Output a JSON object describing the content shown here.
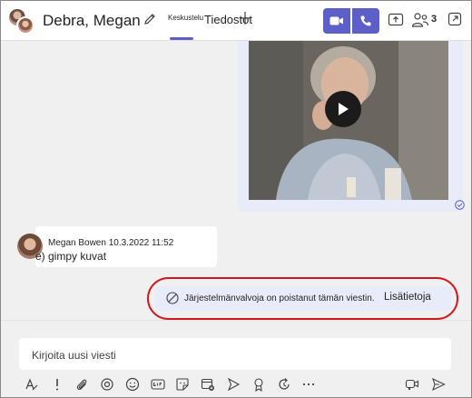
{
  "header": {
    "title": "Debra, Megan",
    "tabs": [
      {
        "label": "Keskustelu",
        "active": true
      },
      {
        "label": "Tiedostot",
        "active": false
      }
    ],
    "participant_count": "3"
  },
  "messages": [
    {
      "type": "video",
      "media": "video-thumbnail"
    },
    {
      "type": "text",
      "author_meta": "Megan Bowen 10.3.2022 11:52",
      "text": "e) gimpy kuvat"
    },
    {
      "type": "deleted",
      "text": "Järjestelmänvalvoja on poistanut tämän viestin.",
      "link": "Lisätietoja"
    }
  ],
  "compose": {
    "placeholder": "Kirjoita uusi viesti"
  },
  "colors": {
    "accent": "#5b5fc7",
    "bubble_self": "#e8ebfa",
    "highlight_ring": "#d0181f"
  },
  "icons": [
    "edit-icon",
    "plus-icon",
    "video-icon",
    "phone-icon",
    "share-screen-icon",
    "people-icon",
    "popout-icon",
    "play-icon",
    "seen-icon",
    "blocked-icon",
    "format-icon",
    "priority-icon",
    "attach-icon",
    "loop-icon",
    "emoji-icon",
    "gif-icon",
    "sticker-icon",
    "schedule-meeting-icon",
    "stream-icon",
    "praise-icon",
    "loop-refresh-icon",
    "more-icon",
    "audio-message-icon",
    "send-icon"
  ]
}
